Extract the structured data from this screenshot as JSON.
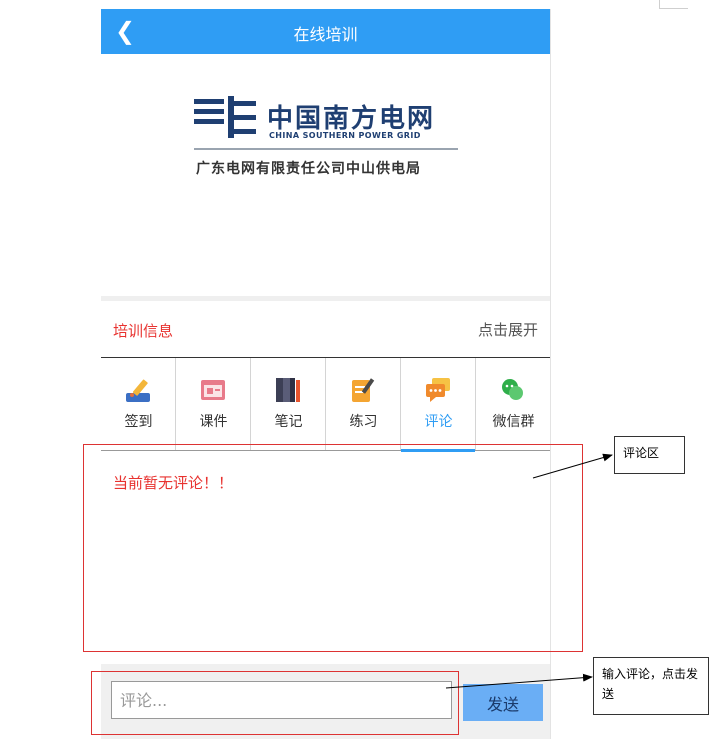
{
  "header": {
    "title": "在线培训",
    "back_icon": "back-arrow-icon"
  },
  "logo": {
    "name_cn": "中国南方电网",
    "name_en": "CHINA SOUTHERN POWER GRID",
    "subtitle": "广东电网有限责任公司中山供电局"
  },
  "info": {
    "title": "培训信息",
    "expand": "点击展开"
  },
  "tabs": [
    {
      "label": "签到",
      "icon": "sign-in-icon"
    },
    {
      "label": "课件",
      "icon": "courseware-icon"
    },
    {
      "label": "笔记",
      "icon": "notes-icon"
    },
    {
      "label": "练习",
      "icon": "practice-icon"
    },
    {
      "label": "评论",
      "icon": "comment-icon",
      "active": true
    },
    {
      "label": "微信群",
      "icon": "wechat-group-icon"
    }
  ],
  "comments": {
    "empty_message": "当前暂无评论！！"
  },
  "input": {
    "placeholder": "评论...",
    "value": "",
    "send_label": "发送"
  },
  "annotations": {
    "comment_area": "评论区",
    "input_hint": "输入评论，点击发送"
  },
  "colors": {
    "header": "#2f9df4",
    "accent_red": "#e8322f",
    "send_button": "#6aaef5",
    "brand_blue": "#1f3f72"
  }
}
